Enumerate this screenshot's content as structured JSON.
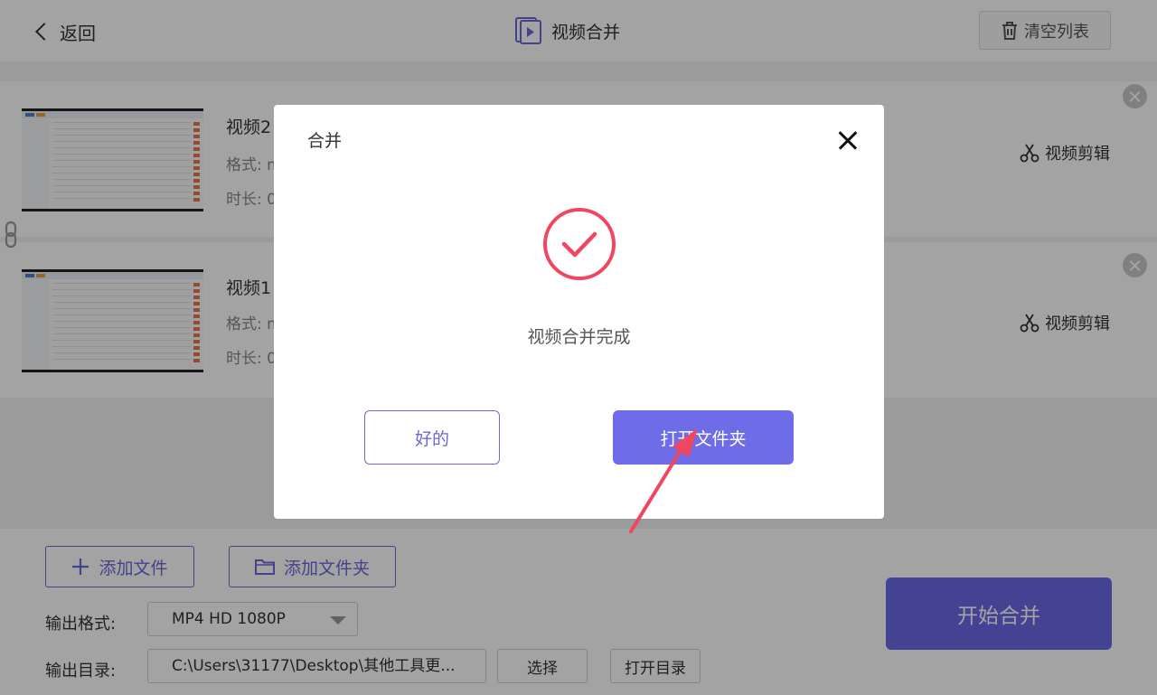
{
  "header": {
    "back_label": "返回",
    "title": "视频合并",
    "clear_label": "清空列表"
  },
  "files": [
    {
      "name": "视频2",
      "format_label": "格式: m",
      "duration_label": "时长: 0",
      "edit_label": "视频剪辑"
    },
    {
      "name": "视频1",
      "format_label": "格式: m",
      "duration_label": "时长: 0",
      "edit_label": "视频剪辑"
    }
  ],
  "bottom": {
    "add_file_label": "添加文件",
    "add_folder_label": "添加文件夹",
    "output_format_label": "输出格式:",
    "output_format_value": "MP4 HD 1080P",
    "output_dir_label": "输出目录:",
    "output_dir_value": "C:\\Users\\31177\\Desktop\\其他工具更...",
    "choose_label": "选择",
    "open_dir_label": "打开目录",
    "start_label": "开始合并"
  },
  "dialog": {
    "title": "合并",
    "message": "视频合并完成",
    "ok_label": "好的",
    "open_folder_label": "打开文件夹"
  },
  "colors": {
    "accent": "#6b68e6",
    "success": "#f0465f",
    "annotation_arrow": "#f0465f"
  },
  "icons": {
    "title": "video-play-icon",
    "clear": "trash-icon",
    "edit": "scissors-icon",
    "remove": "close-circle-icon",
    "link": "chain-link-icon",
    "add_file": "plus-icon",
    "add_folder": "folder-icon",
    "success": "check-circle-icon"
  }
}
